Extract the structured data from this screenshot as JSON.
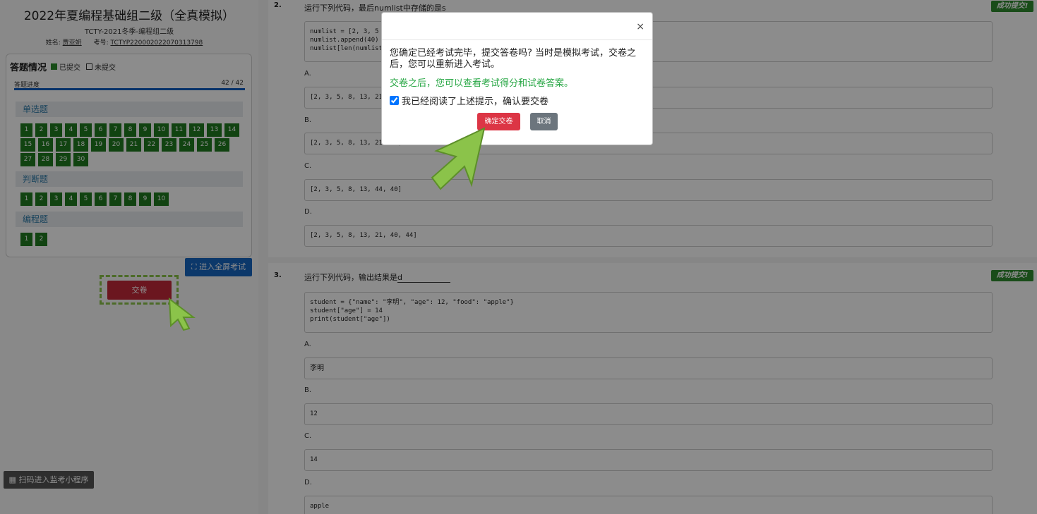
{
  "exam": {
    "title": "2022年夏编程基础组二级（全真模拟）",
    "subtitle": "TCTY-2021冬季-编程组二级",
    "name_label": "姓名:",
    "name_value": "贾亚妍",
    "id_label": "考号:",
    "id_value": "TCTYP220002022070313798"
  },
  "status": {
    "heading": "答题情况",
    "legend_submitted": "已提交",
    "legend_unsubmitted": "未提交",
    "progress_label": "答题进度",
    "progress_text": "42 / 42",
    "progress_fraction": 1.0,
    "sections": [
      {
        "title": "单选题",
        "items": [
          "1",
          "2",
          "3",
          "4",
          "5",
          "6",
          "7",
          "8",
          "9",
          "10",
          "11",
          "12",
          "13",
          "14",
          "15",
          "16",
          "17",
          "18",
          "19",
          "20",
          "21",
          "22",
          "23",
          "24",
          "25",
          "26",
          "27",
          "28",
          "29",
          "30"
        ]
      },
      {
        "title": "判断题",
        "items": [
          "1",
          "2",
          "3",
          "4",
          "5",
          "6",
          "7",
          "8",
          "9",
          "10"
        ]
      },
      {
        "title": "编程题",
        "items": [
          "1",
          "2"
        ]
      }
    ]
  },
  "buttons": {
    "fullscreen": "进入全屏考试",
    "submit": "交卷",
    "qr": "扫码进入监考小程序"
  },
  "questions": {
    "q2": {
      "number": "2.",
      "text": "运行下列代码，最后numlist中存储的是",
      "answer": "s",
      "badge": "成功提交!",
      "code": "numlist = [2, 3, 5\nnumlist.append(40)\nnumlist[len(numlist",
      "options": [
        {
          "label": "A.",
          "value": "[2, 3, 5, 8, 13, 21"
        },
        {
          "label": "B.",
          "value": "[2, 3, 5, 8, 13, 21, 40]"
        },
        {
          "label": "C.",
          "value": "[2, 3, 5, 8, 13, 44, 40]"
        },
        {
          "label": "D.",
          "value": "[2, 3, 5, 8, 13, 21, 40, 44]"
        }
      ]
    },
    "q3": {
      "number": "3.",
      "text": "运行下列代码，输出结果是",
      "answer": "d",
      "badge": "成功提交!",
      "code": "student = {\"name\": \"李明\", \"age\": 12, \"food\": \"apple\"}\nstudent[\"age\"] = 14\nprint(student[\"age\"])",
      "options": [
        {
          "label": "A.",
          "value": "李明"
        },
        {
          "label": "B.",
          "value": "12"
        },
        {
          "label": "C.",
          "value": "14"
        },
        {
          "label": "D.",
          "value": "apple"
        }
      ]
    }
  },
  "modal": {
    "close": "×",
    "message": "您确定已经考试完毕，提交答卷吗? 当时是模拟考试，交卷之后，您可以重新进入考试。",
    "note": "交卷之后，您可以查看考试得分和试卷答案。",
    "checkbox_label": "我已经阅读了上述提示，确认要交卷",
    "checkbox_checked": true,
    "confirm": "确定交卷",
    "cancel": "取消"
  },
  "colors": {
    "submitted": "#1f7a1f",
    "progress": "#0d5bbf",
    "danger": "#dc3545",
    "success_text": "#28a745",
    "hint_arrow": "#8bc34a"
  }
}
